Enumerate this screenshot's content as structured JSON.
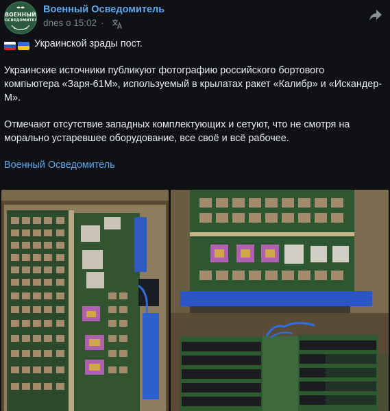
{
  "channel": {
    "name": "Военный Осведомитель",
    "avatar_text_line1": "ВОЕННЫЙ",
    "avatar_text_line2": "ОСВЕДОМИТЕЛЬ"
  },
  "meta": {
    "time": "dnes o 15:02",
    "separator": "·"
  },
  "icons": {
    "translate": "translate-icon",
    "share": "share-icon"
  },
  "post": {
    "line1": "Украинской зрады пост.",
    "line2": "Украинские источники публикуют фотографию российского бортового",
    "line3": "компьютера «Заря-61М», используемый в крылатах ракет «Калибр» и «Искандер-",
    "line4": "М».",
    "line5": "Отмечают отсутствие западных комплектующих и сетуют, что не смотря на",
    "line6": "морально устаревшее оборудование, все своё и всё рабочее.",
    "signature": "Военный Осведомитель"
  },
  "photos": [
    {
      "subject": "circuit-board-photo-left"
    },
    {
      "subject": "circuit-board-photo-right"
    }
  ],
  "colors": {
    "background": "#0f1114",
    "link": "#5fa8ec",
    "text": "#e9ecef",
    "muted": "#7f868d",
    "avatar": "#2c5a3e"
  }
}
